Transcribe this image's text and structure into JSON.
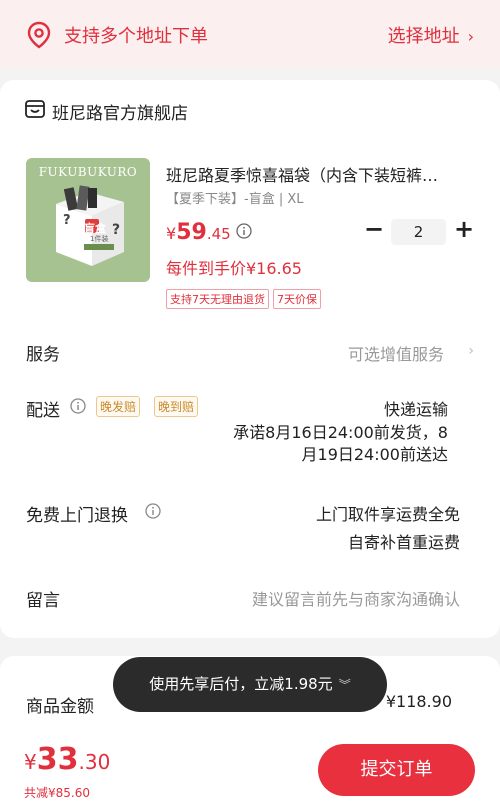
{
  "address": {
    "prompt": "支持多个地址下单",
    "choose_label": "选择地址",
    "icon": "location-pin-icon"
  },
  "shop": {
    "name": "班尼路官方旗舰店",
    "icon": "store-icon"
  },
  "product": {
    "image_text_brand": "FUKUBUKURO",
    "image_text_box": "盲盒",
    "image_text_count": "1件装",
    "title": "班尼路夏季惊喜福袋（内含下装短裤…",
    "spec": "【夏季下装】-盲盒 | XL",
    "price_currency": "¥",
    "price_int": "59",
    "price_dec": ".45",
    "quantity": "2",
    "unit_price": "每件到手价¥16.65",
    "tags": [
      "支持7天无理由退货",
      "7天价保"
    ]
  },
  "rows": {
    "service_label": "服务",
    "service_value": "可选增值服务",
    "delivery_label": "配送",
    "delivery_badges": [
      "晚发赔",
      "晚到赔"
    ],
    "delivery_method": "快递运输",
    "delivery_promise": "承诺8月16日24:00前发货，8月19日24:00前送达",
    "return_label": "免费上门退换",
    "return_line1": "上门取件享运费全免",
    "return_line2": "自寄补首重运费",
    "message_label": "留言",
    "message_placeholder": "建议留言前先与商家沟通确认"
  },
  "summary": {
    "goods_label": "商品金额",
    "goods_value": "¥118.90"
  },
  "toast": {
    "text": "使用先享后付，立减1.98元"
  },
  "footer": {
    "currency": "¥",
    "total_int": "33",
    "total_dec": ".30",
    "saved": "共减¥85.60",
    "submit_label": "提交订单"
  },
  "colors": {
    "accent": "#e0303d",
    "badge": "#c8892a"
  }
}
